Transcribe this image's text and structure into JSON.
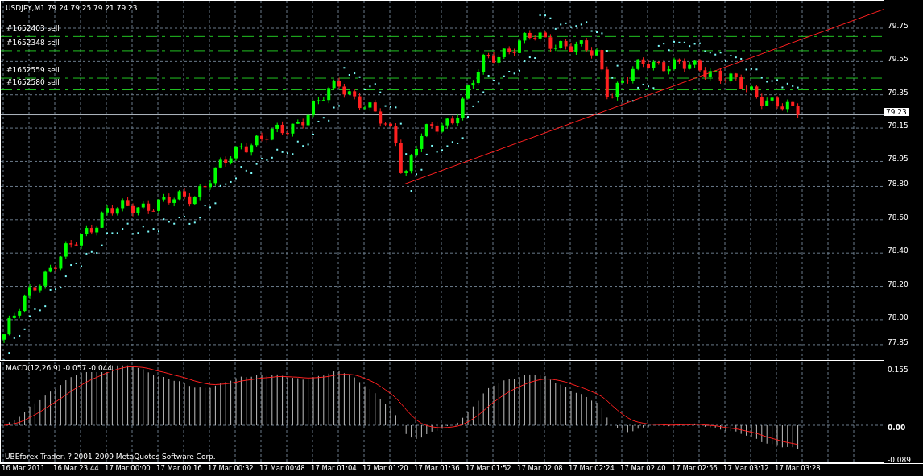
{
  "chart": {
    "symbol_info": "USDJPY,M1  79.24 79.25 79.21 79.23",
    "orders": [
      {
        "label": "#1652403 sell"
      },
      {
        "label": "#1652348 sell"
      },
      {
        "label": "#1652559 sell"
      },
      {
        "label": "#1652580 sell"
      }
    ],
    "price_axis": [
      "79.75",
      "79.55",
      "79.35",
      "79.15",
      "78.95",
      "78.80",
      "78.60",
      "78.40",
      "78.20",
      "78.00",
      "77.85"
    ],
    "current_price": "79.23"
  },
  "macd": {
    "label": "MACD(12,26,9) -0.057 -0.044",
    "copyright": "UBEforex Trader, ? 2001-2009 MetaQuotes Software Corp.",
    "axis": [
      "0.155",
      "0.00",
      "-0.089"
    ]
  },
  "time_axis": [
    "16 Mar 2011",
    "16 Mar 23:44",
    "17 Mar 00:00",
    "17 Mar 00:16",
    "17 Mar 00:32",
    "17 Mar 00:48",
    "17 Mar 01:04",
    "17 Mar 01:20",
    "17 Mar 01:36",
    "17 Mar 01:52",
    "17 Mar 02:08",
    "17 Mar 02:24",
    "17 Mar 02:40",
    "17 Mar 02:56",
    "17 Mar 03:12",
    "17 Mar 03:28"
  ]
}
